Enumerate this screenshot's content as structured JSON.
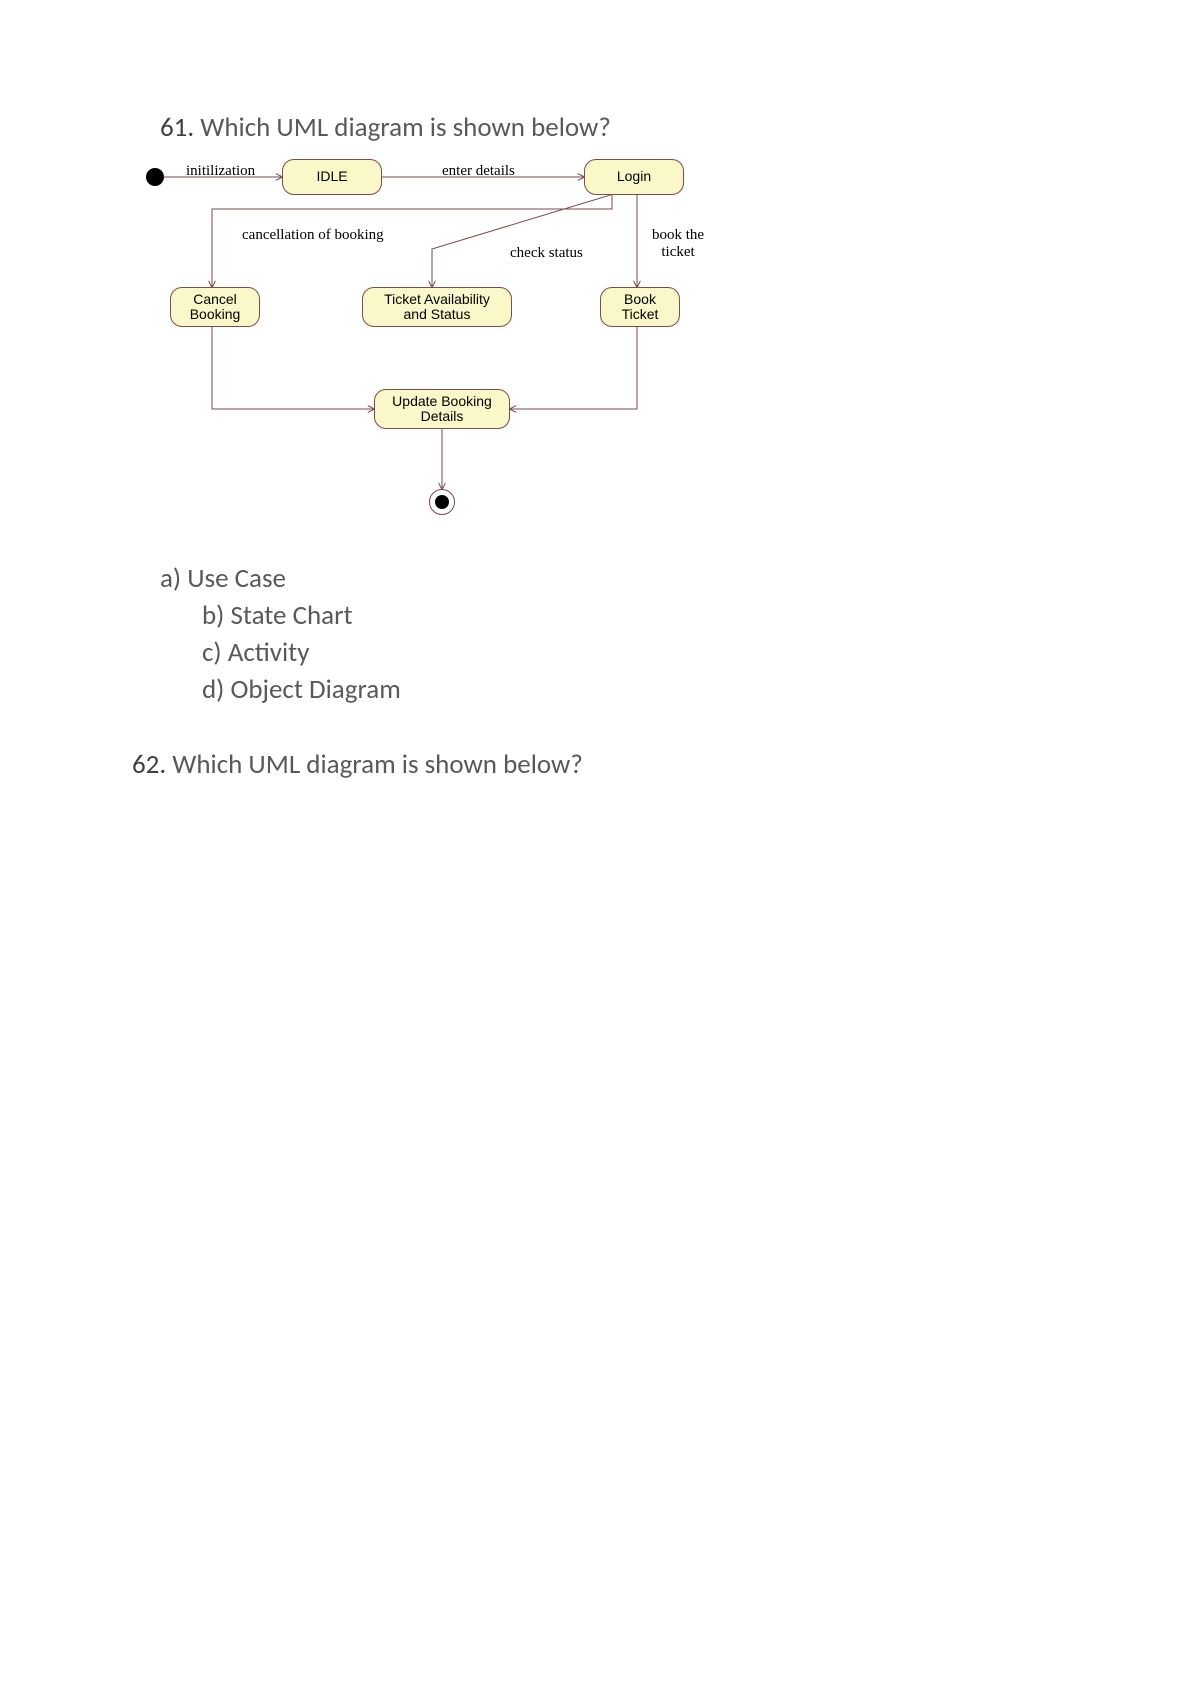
{
  "q61": {
    "num": "61.",
    "text": "Which UML diagram is shown below?",
    "options": {
      "a": "a) Use Case",
      "b": "b) State Chart",
      "c": "c) Activity",
      "d": "d) Object Diagram"
    }
  },
  "q62": {
    "num": "62.",
    "text": "Which UML diagram is shown below?"
  },
  "diagram": {
    "states": {
      "idle": "IDLE",
      "login": "Login",
      "cancel": "Cancel\nBooking",
      "avail": "Ticket Availability\nand Status",
      "book": "Book\nTicket",
      "update": "Update Booking\nDetails"
    },
    "labels": {
      "init": "initilization",
      "enter": "enter details",
      "cancelb": "cancellation of booking",
      "check": "check status",
      "bookt": "book the\nticket"
    }
  }
}
